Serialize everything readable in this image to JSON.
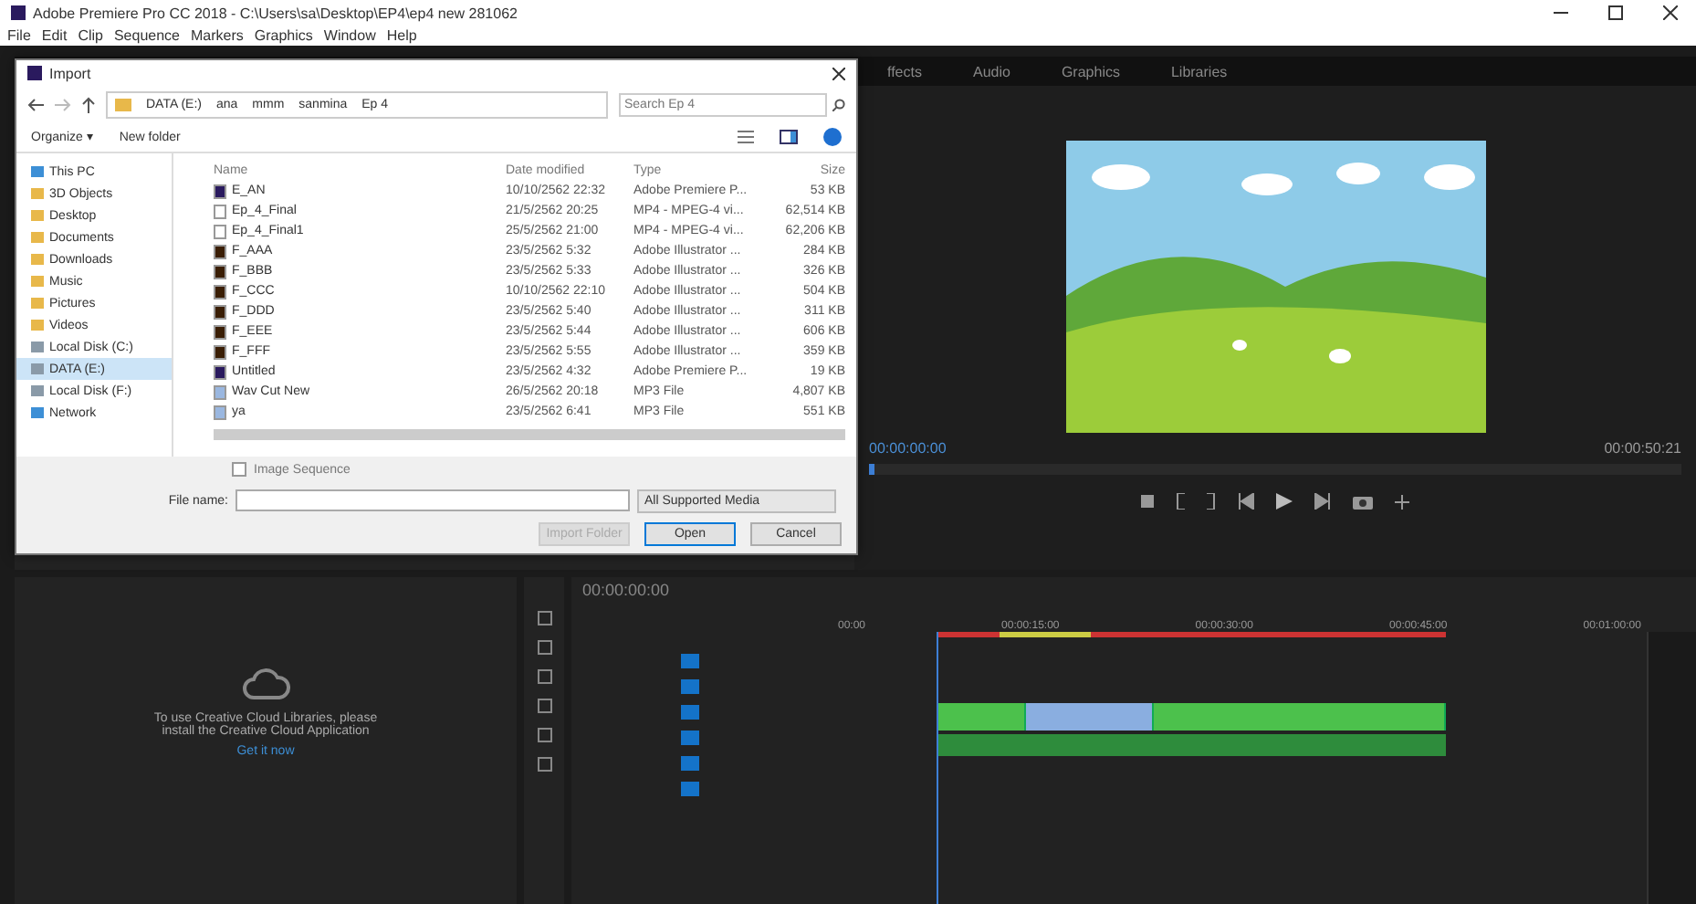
{
  "window": {
    "title": "Adobe Premiere Pro CC 2018 - C:\\Users\\sa\\Desktop\\EP4\\ep4 new 281062"
  },
  "menu": [
    "File",
    "Edit",
    "Clip",
    "Sequence",
    "Markers",
    "Graphics",
    "Window",
    "Help"
  ],
  "workspace_tabs": [
    "ffects",
    "Audio",
    "Graphics",
    "Libraries"
  ],
  "program_monitor": {
    "timecode": "00:00:00:00",
    "duration": "00:00:50:21"
  },
  "libraries_panel": {
    "message": "To use Creative Cloud Libraries, please install the Creative Cloud Application",
    "link": "Get it now"
  },
  "timeline": {
    "timecode": "00:00:00:00",
    "ruler": [
      "00:00",
      "00:00:15:00",
      "00:00:30:00",
      "00:00:45:00",
      "00:01:00:00"
    ],
    "video_clips": [
      {
        "selected": false
      },
      {
        "selected": true
      },
      {
        "selected": false
      }
    ]
  },
  "import_dialog": {
    "title": "Import",
    "path": [
      "DATA (E:)",
      "ana",
      "mmm",
      "sanmina",
      "Ep 4"
    ],
    "search": {
      "placeholder": "Search Ep 4"
    },
    "toolbar": [
      "Organize ▾",
      "New folder"
    ],
    "sidebar": [
      {
        "label": "This PC",
        "selected": false,
        "kind": "pc"
      },
      {
        "label": "3D Objects",
        "selected": false,
        "kind": "folder"
      },
      {
        "label": "Desktop",
        "selected": false,
        "kind": "folder"
      },
      {
        "label": "Documents",
        "selected": false,
        "kind": "folder"
      },
      {
        "label": "Downloads",
        "selected": false,
        "kind": "folder"
      },
      {
        "label": "Music",
        "selected": false,
        "kind": "folder"
      },
      {
        "label": "Pictures",
        "selected": false,
        "kind": "folder"
      },
      {
        "label": "Videos",
        "selected": false,
        "kind": "folder"
      },
      {
        "label": "Local Disk (C:)",
        "selected": false,
        "kind": "drive"
      },
      {
        "label": "DATA (E:)",
        "selected": true,
        "kind": "drive"
      },
      {
        "label": "Local Disk (F:)",
        "selected": false,
        "kind": "drive"
      },
      {
        "label": "Network",
        "selected": false,
        "kind": "network"
      }
    ],
    "columns": [
      "Name",
      "Date modified",
      "Type",
      "Size"
    ],
    "files": [
      {
        "name": "E_AN",
        "date": "10/10/2562 22:32",
        "type": "Adobe Premiere P...",
        "size": "53 KB",
        "kind": "premiere"
      },
      {
        "name": "Ep_4_Final",
        "date": "21/5/2562 20:25",
        "type": "MP4 - MPEG-4 vi...",
        "size": "62,514 KB",
        "kind": "video"
      },
      {
        "name": "Ep_4_Final1",
        "date": "25/5/2562 21:00",
        "type": "MP4 - MPEG-4 vi...",
        "size": "62,206 KB",
        "kind": "video"
      },
      {
        "name": "F_AAA",
        "date": "23/5/2562 5:32",
        "type": "Adobe Illustrator ...",
        "size": "284 KB",
        "kind": "illustrator"
      },
      {
        "name": "F_BBB",
        "date": "23/5/2562 5:33",
        "type": "Adobe Illustrator ...",
        "size": "326 KB",
        "kind": "illustrator"
      },
      {
        "name": "F_CCC",
        "date": "10/10/2562 22:10",
        "type": "Adobe Illustrator ...",
        "size": "504 KB",
        "kind": "illustrator"
      },
      {
        "name": "F_DDD",
        "date": "23/5/2562 5:40",
        "type": "Adobe Illustrator ...",
        "size": "311 KB",
        "kind": "illustrator"
      },
      {
        "name": "F_EEE",
        "date": "23/5/2562 5:44",
        "type": "Adobe Illustrator ...",
        "size": "606 KB",
        "kind": "illustrator"
      },
      {
        "name": "F_FFF",
        "date": "23/5/2562 5:55",
        "type": "Adobe Illustrator ...",
        "size": "359 KB",
        "kind": "illustrator"
      },
      {
        "name": "Untitled",
        "date": "23/5/2562 4:32",
        "type": "Adobe Premiere P...",
        "size": "19 KB",
        "kind": "premiere"
      },
      {
        "name": "Wav Cut New",
        "date": "26/5/2562 20:18",
        "type": "MP3 File",
        "size": "4,807 KB",
        "kind": "audio"
      },
      {
        "name": "ya",
        "date": "23/5/2562 6:41",
        "type": "MP3 File",
        "size": "551 KB",
        "kind": "audio"
      }
    ],
    "image_sequence": {
      "label": "Image Sequence",
      "checked": false
    },
    "file_name_label": "File name:",
    "filter": "All Supported Media",
    "buttons": [
      {
        "label": "Import Folder",
        "disabled": true
      },
      {
        "label": "Open",
        "disabled": false
      },
      {
        "label": "Cancel",
        "disabled": false
      }
    ]
  }
}
